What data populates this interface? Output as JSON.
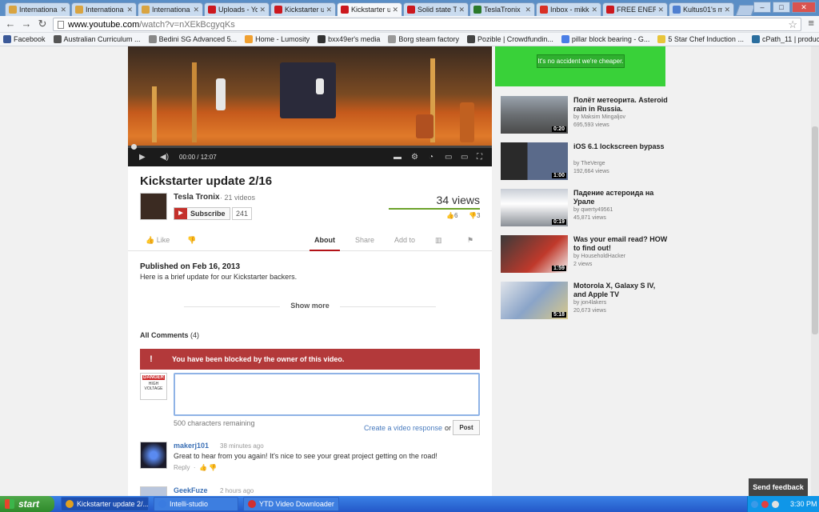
{
  "browser": {
    "tabs": [
      {
        "label": "Internationa",
        "color": "#d9a441"
      },
      {
        "label": "Internationa",
        "color": "#d9a441"
      },
      {
        "label": "Internationa",
        "color": "#d9a441"
      },
      {
        "label": "Uploads - Yo",
        "color": "#cc181e"
      },
      {
        "label": "Kickstarter u",
        "color": "#cc181e"
      },
      {
        "label": "Kickstarter u",
        "color": "#cc181e",
        "active": true
      },
      {
        "label": "Solid state T",
        "color": "#cc181e"
      },
      {
        "label": "TeslaTronix",
        "color": "#2b7a2b"
      },
      {
        "label": "Inbox - mikk",
        "color": "#d93025"
      },
      {
        "label": "FREE ENERG",
        "color": "#cc181e"
      },
      {
        "label": "Kultus01's m",
        "color": "#4f7fd0"
      }
    ],
    "url_host": "www.youtube.com",
    "url_path": "/watch?v=nXEkBcgyqKs",
    "bookmarks": [
      {
        "label": "Facebook",
        "color": "#3b5998"
      },
      {
        "label": "Australian Curriculum ...",
        "color": "#555"
      },
      {
        "label": "Bedini SG Advanced 5...",
        "color": "#888"
      },
      {
        "label": "Home - Lumosity",
        "color": "#f0a030"
      },
      {
        "label": "bxx49er's media",
        "color": "#333"
      },
      {
        "label": "Borg steam factory",
        "color": "#999"
      },
      {
        "label": "Pozible | Crowdfundin...",
        "color": "#444"
      },
      {
        "label": "pillar block bearing - G...",
        "color": "#4a7ee6"
      },
      {
        "label": "5 Star Chef Induction ...",
        "color": "#e8c53a"
      },
      {
        "label": "cPath_11 | products_i...",
        "color": "#2a6e9e"
      }
    ]
  },
  "video": {
    "time": "00:00 / 12:07",
    "title": "Kickstarter update 2/16",
    "channel": "Tesla Tronix",
    "video_count": "· 21 videos",
    "subscribe_label": "Subscribe",
    "subscribe_count": "241",
    "views": "34 views",
    "likes": "6",
    "dislikes": "3",
    "like_label": "Like",
    "tabs": [
      "About",
      "Share",
      "Add to"
    ],
    "published": "Published on Feb 16, 2013",
    "description": "Here is a brief update for our Kickstarter backers.",
    "show_more": "Show more"
  },
  "comments": {
    "header_label": "All Comments",
    "header_count": "(4)",
    "blocked_message": "You have been blocked by the owner of this video.",
    "remaining": "500 characters remaining",
    "video_response": "Create a video response",
    "or_label": "or",
    "post_label": "Post",
    "danger_top": "DANGER",
    "danger_sub": "HIGH VOLTAGE",
    "items": [
      {
        "user": "makerj101",
        "time": "38 minutes ago",
        "text": "Great to hear from you again! It's nice to see your great project getting on the road!",
        "reply": "Reply",
        "dot": "·"
      },
      {
        "user": "GeekFuze",
        "time": "2 hours ago",
        "text": "",
        "reply": "",
        "dot": ""
      }
    ]
  },
  "sidebar": {
    "ad_text": "It's no accident we're cheaper.",
    "related": [
      {
        "title": "Полёт метеорита. Asteroid rain in Russia.",
        "by": "by Maksim Mingaljov",
        "views": "695,593 views",
        "duration": "0:20"
      },
      {
        "title": "iOS 6.1 lockscreen bypass",
        "by": "by TheVerge",
        "views": "192,664 views",
        "duration": "1:00"
      },
      {
        "title": "Падение астероида на Урале",
        "by": "by qwerty49561",
        "views": "45,871 views",
        "duration": "0:19"
      },
      {
        "title": "Was your email read? HOW to find out!",
        "by": "by HouseholdHacker",
        "views": "2 views",
        "duration": "1:59"
      },
      {
        "title": "Motorola X, Galaxy S IV, and Apple TV",
        "by": "by jon4lakers",
        "views": "20,673 views",
        "duration": "5:18"
      }
    ]
  },
  "feedback_label": "Send feedback",
  "taskbar": {
    "start": "start",
    "tasks": [
      {
        "label": "Kickstarter update 2/...",
        "color": "#e0a020",
        "active": true
      },
      {
        "label": "Intelli-studio",
        "color": "#3a7be0"
      },
      {
        "label": "YTD Video Downloader",
        "color": "#d03030"
      }
    ],
    "clock": "3:30 PM"
  }
}
